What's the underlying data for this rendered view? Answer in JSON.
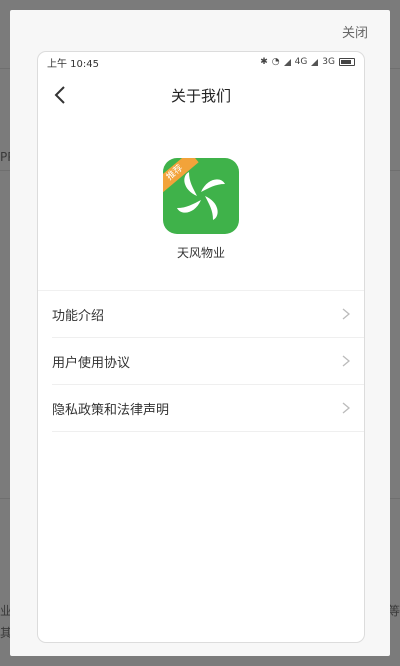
{
  "modal": {
    "close_label": "关闭"
  },
  "status_bar": {
    "time": "上午 10:45",
    "network_1": "4G",
    "network_2": "3G"
  },
  "nav": {
    "title": "关于我们",
    "back_icon": "chevron-left-icon"
  },
  "app": {
    "name": "天风物业",
    "badge": "推荐",
    "icon": "pinwheel-icon",
    "color": "#3fb24a",
    "badge_color": "#f2a33a"
  },
  "menu": {
    "items": [
      {
        "label": "功能介绍"
      },
      {
        "label": "用户使用协议"
      },
      {
        "label": "隐私政策和法律声明"
      }
    ]
  },
  "background": {
    "frag_left_1": "PP",
    "frag_left_2": "业",
    "frag_left_3": "其",
    "frag_right_1": "等"
  }
}
